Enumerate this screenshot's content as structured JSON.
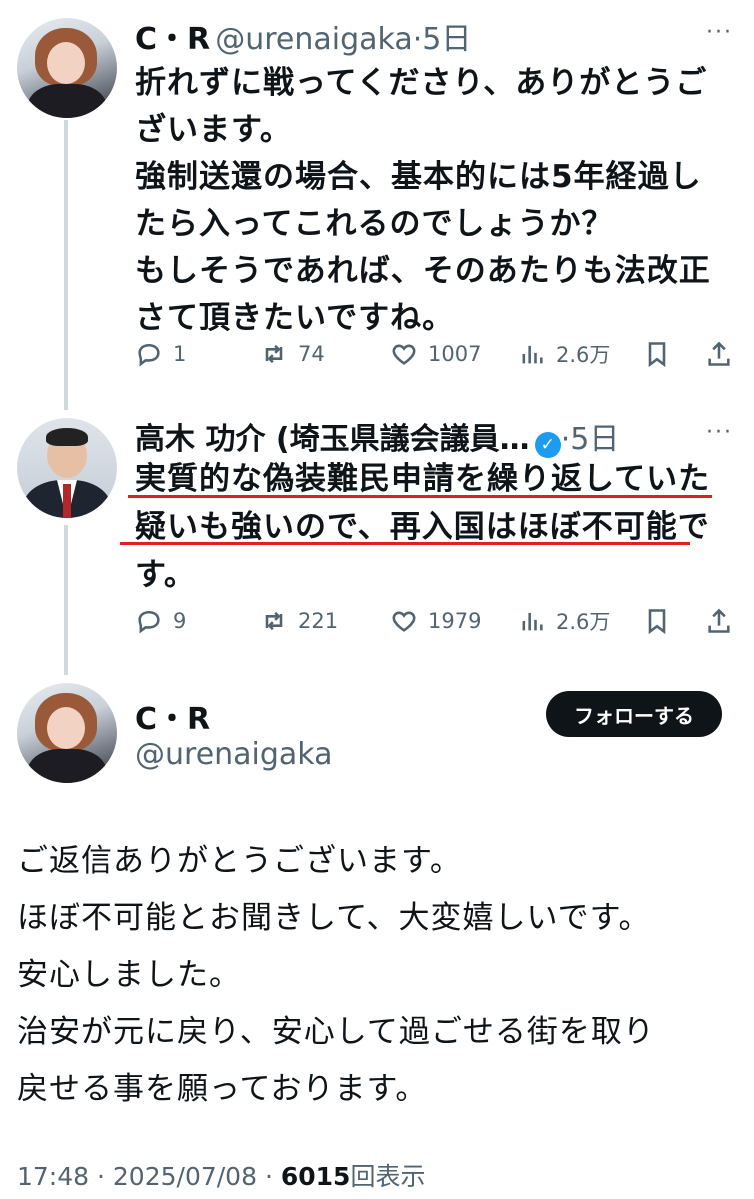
{
  "tweet1": {
    "name": "C・R",
    "handle": "@urenaigaka",
    "time": "·5日",
    "text": "折れずに戦ってくださり、ありがとうご\nざいます。\n強制送還の場合、基本的には5年経過し\nたら入ってこれるのでしょうか？\nもしそうであれば、そのあたりも法改正\nさて頂きたいですね。",
    "replies": "1",
    "retweets": "74",
    "likes": "1007",
    "views": "2.6万"
  },
  "tweet2": {
    "name": "高木 功介 (埼玉県議会議員…",
    "verified": "✓",
    "time": "·5日",
    "line1": "実質的な偽装難民申請を繰り返していた",
    "line2": "疑いも強いので、再入国はほぼ不可能で",
    "line3": "す。",
    "replies": "9",
    "retweets": "221",
    "likes": "1979",
    "views": "2.6万"
  },
  "main": {
    "name": "C・R",
    "handle": "@urenaigaka",
    "follow_label": "フォローする",
    "text": "ご返信ありがとうございます。\nほぼ不可能とお聞きして、大変嬉しいです。\n安心しました。\n治安が元に戻り、安心して過ごせる街を取り\n戻せる事を願っております。",
    "time": "17:48",
    "date": "2025/07/08",
    "views_count": "6015",
    "views_label": "回表示"
  },
  "more_label": "···",
  "colors": {
    "accent": "#1d9bf0",
    "underline": "#e02020",
    "muted": "#536471"
  }
}
